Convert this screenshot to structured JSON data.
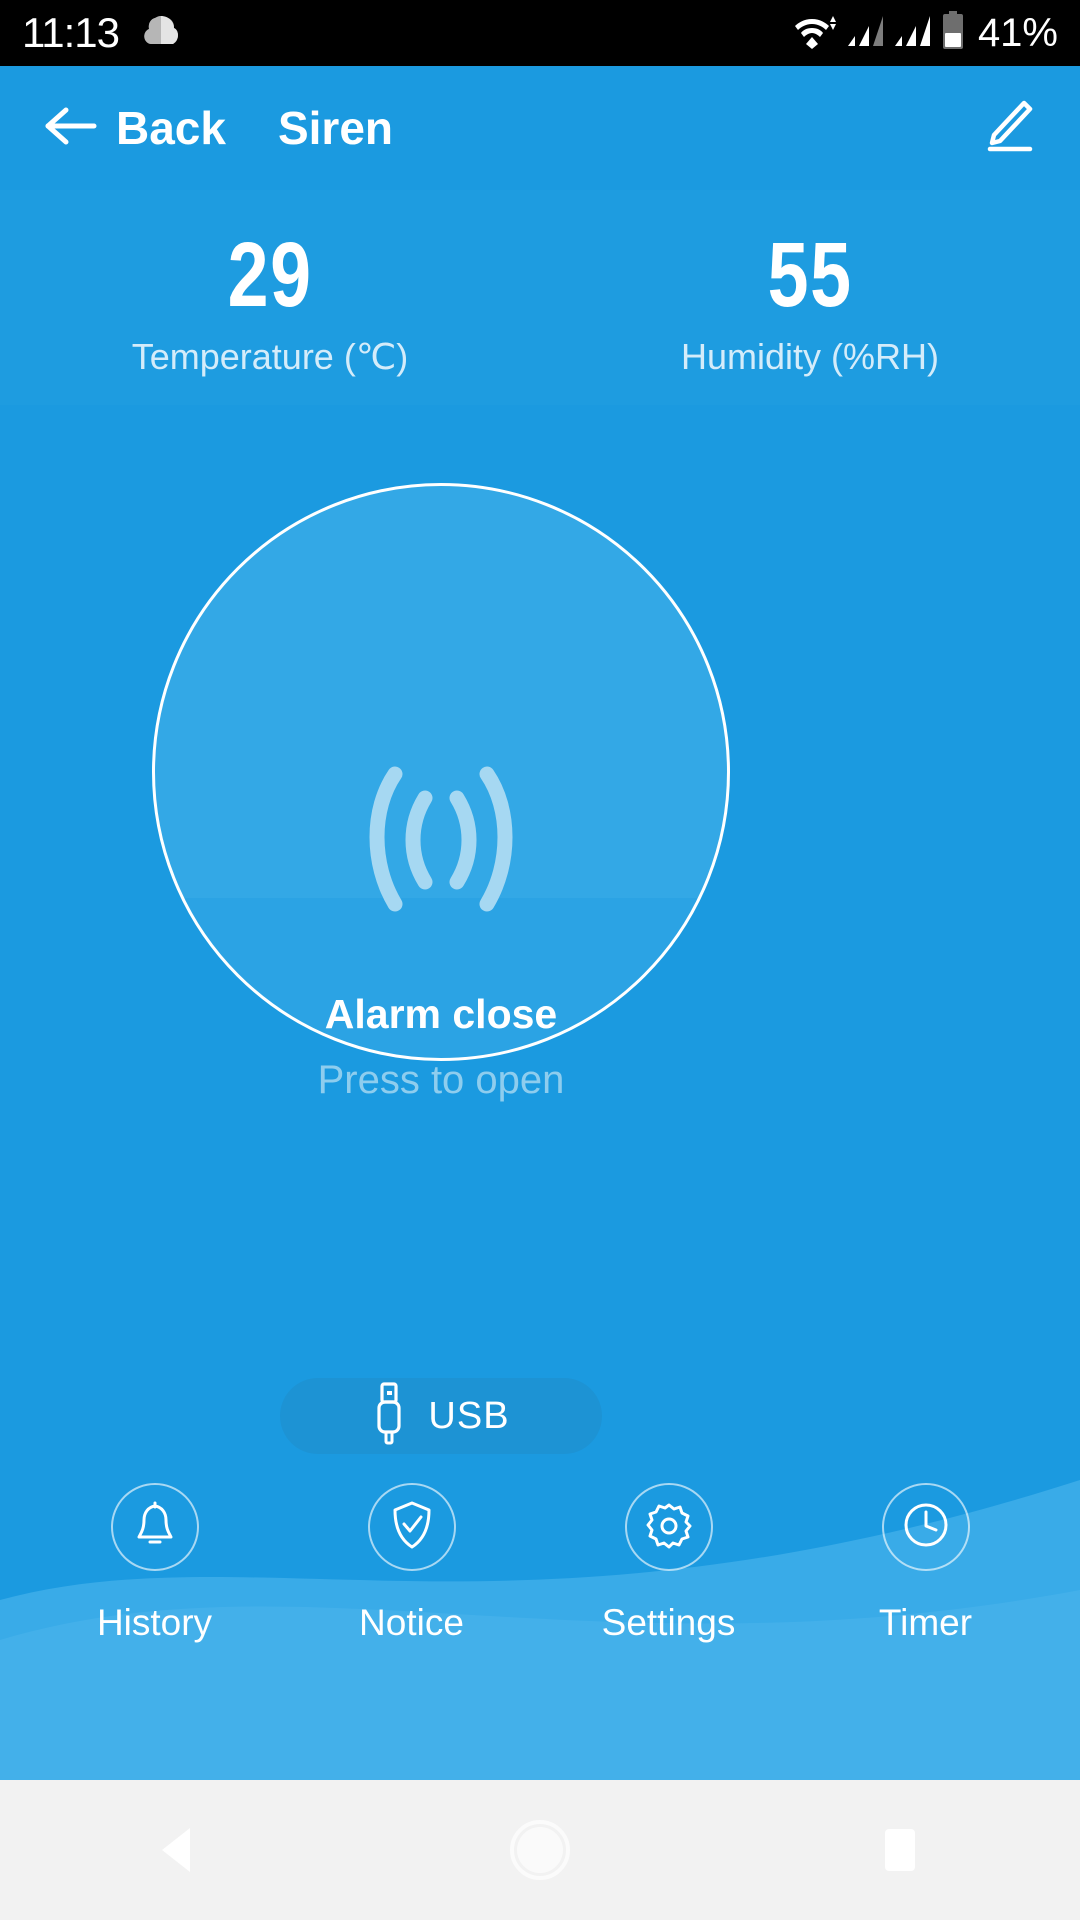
{
  "status_bar": {
    "time": "11:13",
    "battery_percent": "41%",
    "icons": [
      "cloud-icon",
      "wifi-icon",
      "signal-icon-1",
      "signal-icon-2",
      "battery-icon"
    ]
  },
  "header": {
    "back_label": "Back",
    "title": "Siren",
    "back_icon": "arrow-left-icon",
    "edit_icon": "pencil-icon"
  },
  "sensors": [
    {
      "value": "29",
      "label": "Temperature (℃)",
      "name": "temperature"
    },
    {
      "value": "55",
      "label": "Humidity (%RH)",
      "name": "humidity"
    }
  ],
  "alarm": {
    "state": "Alarm close",
    "hint": "Press to open",
    "icon": "siren-waves-icon"
  },
  "usb_button": {
    "label": "USB",
    "icon": "usb-plug-icon"
  },
  "bottom_nav": [
    {
      "label": "History",
      "icon": "bell-icon"
    },
    {
      "label": "Notice",
      "icon": "shield-check-icon"
    },
    {
      "label": "Settings",
      "icon": "gear-icon"
    },
    {
      "label": "Timer",
      "icon": "clock-icon"
    }
  ],
  "android_nav": [
    {
      "name": "back",
      "icon": "triangle-back-icon"
    },
    {
      "name": "home",
      "icon": "circle-home-icon"
    },
    {
      "name": "recents",
      "icon": "square-recents-icon"
    }
  ],
  "colors": {
    "brand_blue": "#1b9ae0",
    "strip_blue": "#1e9ce0",
    "circle_fill": "#33a8e6",
    "usb_pill": "#1d93d4",
    "label_blue": "#d4ecfa",
    "hint_blue": "#8ecdee",
    "nav_bar_gray": "#f2f2f2"
  }
}
